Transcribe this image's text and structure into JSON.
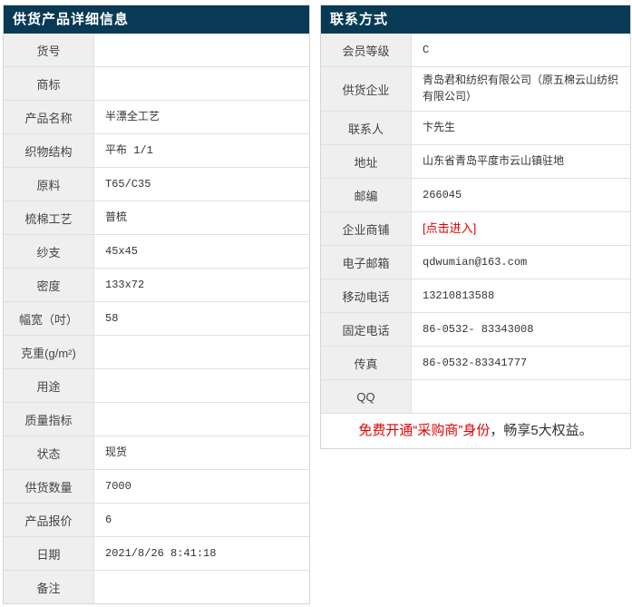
{
  "colors": {
    "header_bg": "#083a55",
    "header_text": "#ffffff",
    "label_bg": "#efefef",
    "border": "#e0e0e0",
    "label_text": "#444444",
    "value_text": "#333333",
    "red": "#e60000"
  },
  "product_table": {
    "title": "供货产品详细信息",
    "rows": [
      {
        "label": "货号",
        "value": ""
      },
      {
        "label": "商标",
        "value": ""
      },
      {
        "label": "产品名称",
        "value": "半漂全工艺"
      },
      {
        "label": "织物结构",
        "value": "平布 1/1"
      },
      {
        "label": "原料",
        "value": "T65/C35"
      },
      {
        "label": "梳棉工艺",
        "value": "普梳"
      },
      {
        "label": "纱支",
        "value": "45x45"
      },
      {
        "label": "密度",
        "value": "133x72"
      },
      {
        "label": "幅宽（吋）",
        "value": "58"
      },
      {
        "label": "克重(g/m²)",
        "value": ""
      },
      {
        "label": "用途",
        "value": ""
      },
      {
        "label": "质量指标",
        "value": ""
      },
      {
        "label": "状态",
        "value": "现货"
      },
      {
        "label": "供货数量",
        "value": "7000"
      },
      {
        "label": "产品报价",
        "value": "6"
      },
      {
        "label": "日期",
        "value": "2021/8/26 8:41:18"
      },
      {
        "label": "备注",
        "value": ""
      }
    ]
  },
  "contact_table": {
    "title": "联系方式",
    "rows": [
      {
        "label": "会员等级",
        "value": "C"
      },
      {
        "label": "供货企业",
        "value": "青岛君和纺织有限公司（原五棉云山纺织有限公司）"
      },
      {
        "label": "联系人",
        "value": "卞先生"
      },
      {
        "label": "地址",
        "value": "山东省青岛平度市云山镇驻地"
      },
      {
        "label": "邮编",
        "value": "266045"
      },
      {
        "label": "企业商铺",
        "value": "[点击进入]",
        "link": true
      },
      {
        "label": "电子邮箱",
        "value": "qdwumian@163.com"
      },
      {
        "label": "移动电话",
        "value": "13210813588"
      },
      {
        "label": "固定电话",
        "value": "86-0532- 83343008"
      },
      {
        "label": "传真",
        "value": "86-0532-83341777"
      },
      {
        "label": "QQ",
        "value": ""
      }
    ],
    "footer": {
      "red_text": "免费开通“采购商”身份",
      "normal_text": "，畅享5大权益。"
    }
  }
}
